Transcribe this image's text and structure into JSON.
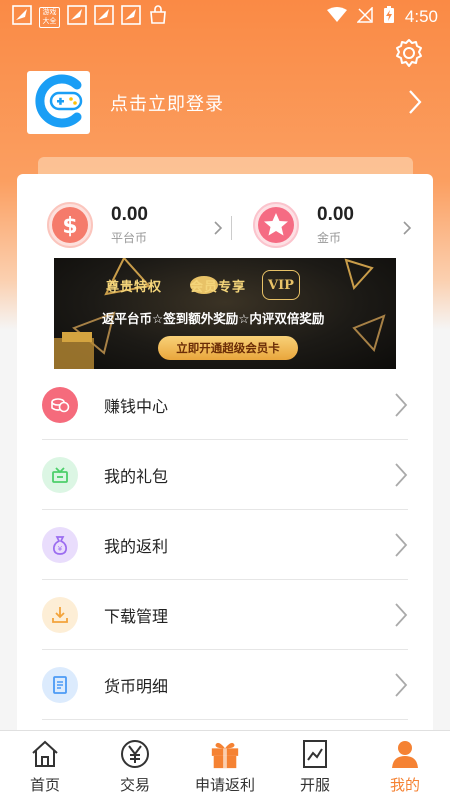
{
  "status_bar": {
    "time": "4:50",
    "notif_icon_text": "游戏大全"
  },
  "profile": {
    "login_label": "点击立即登录"
  },
  "coins": {
    "platform_value": "0.00",
    "platform_label": "平台币",
    "gold_value": "0.00",
    "gold_label": "金币"
  },
  "banner": {
    "title": "尊贵特权",
    "member_text": "会员专享",
    "vip_text": "VIP",
    "subtitle": "返平台币☆签到额外奖励☆内评双倍奖励",
    "button_label": "立即开通超级会员卡"
  },
  "menu": [
    {
      "label": "赚钱中心",
      "icon": "coins-icon",
      "color": "#f56b7c",
      "bg": "#fde4e8"
    },
    {
      "label": "我的礼包",
      "icon": "gift-box-icon",
      "color": "#4ccf6a",
      "bg": "#e0f7e6"
    },
    {
      "label": "我的返利",
      "icon": "money-bag-icon",
      "color": "#9b6cf0",
      "bg": "#ede4fd"
    },
    {
      "label": "下载管理",
      "icon": "download-icon",
      "color": "#f3a33a",
      "bg": "#fdf0dc"
    },
    {
      "label": "货币明细",
      "icon": "receipt-icon",
      "color": "#4b9af5",
      "bg": "#e0eefd"
    }
  ],
  "nav": [
    {
      "label": "首页",
      "icon": "home-icon"
    },
    {
      "label": "交易",
      "icon": "yen-icon"
    },
    {
      "label": "申请返利",
      "icon": "gift-icon"
    },
    {
      "label": "开服",
      "icon": "chart-icon"
    },
    {
      "label": "我的",
      "icon": "person-icon"
    }
  ],
  "colors": {
    "accent": "#f58233",
    "header_top": "#fa8a45"
  }
}
